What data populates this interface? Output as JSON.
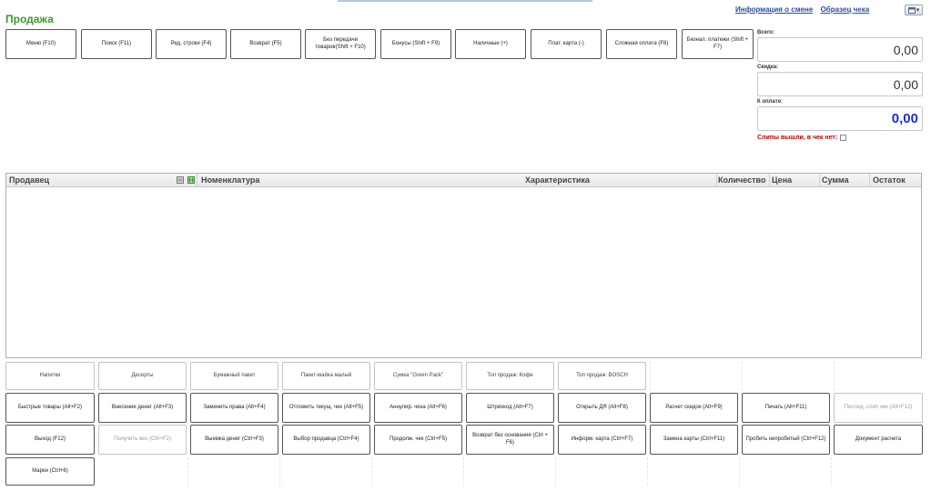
{
  "page": {
    "title": "Продажа"
  },
  "links": {
    "shift_info": "Информация о смене",
    "receipt_sample": "Образец чека"
  },
  "window_menu": {
    "icon": "window-icon",
    "caret": "▾"
  },
  "toolbar": [
    "Меню (F10)",
    "Поиск (F11)",
    "Ред. строки (F4)",
    "Возврат (F5)",
    "Без передачи товаров(Shift + F10)",
    "Бонусы (Shift + F9)",
    "Наличные (+)",
    "Плат. карта (-)",
    "Сложная оплата (F8)",
    "Безнал. платежи (Shift + F7)"
  ],
  "totals": {
    "total_label": "Всего:",
    "total_value": "0,00",
    "discount_label": "Скидка:",
    "discount_value": "0,00",
    "pay_label": "К оплате:",
    "pay_value": "0,00",
    "slips_label": "Слипы вышли, в чек нет:"
  },
  "table": {
    "columns": {
      "seller": "Продавец",
      "item": "Номенклатура",
      "characteristic": "Характеристика",
      "quantity": "Количество",
      "price": "Цена",
      "sum": "Сумма",
      "remainder": "Остаток"
    }
  },
  "quick_row": [
    "Напитки",
    "Десерты",
    "Бумажный пакет",
    "Пакет-майка малый",
    "Сумка \"Green Pack\"",
    "Топ продаж: Кофе",
    "Топ продаж: BOSCH"
  ],
  "action_row1": [
    "Быстрые товары (Alt+F2)",
    "Внесение денег (Alt+F3)",
    "Заменить права (Alt+F4)",
    "Отложить текущ. чек (Alt+F5)",
    "Аннулир. чека (Alt+F6)",
    "Штрихкод (Alt+F7)",
    "Открыть ДЯ (Alt+F8)",
    "Расчет скидок (Alt+F9)",
    "Печать (Alt+F11)",
    "Послед. слип чек (Alt+F12)"
  ],
  "action_row2": [
    "Выход (F12)",
    "Получить вес (Ctrl+F2)",
    "Выемка денег (Ctrl+F3)",
    "Выбор продавца (Ctrl+F4)",
    "Продолж. чек (Ctrl+F5)",
    "Возврат без основания (Ctrl + F6)",
    "Информ. карта (Ctrl+F7)",
    "Замена карты (Ctrl+F11)",
    "Пробить непробитый (Ctrl+F12)",
    "Документ расчета"
  ],
  "action_row3": [
    "Марки (Ctrl+6)"
  ]
}
